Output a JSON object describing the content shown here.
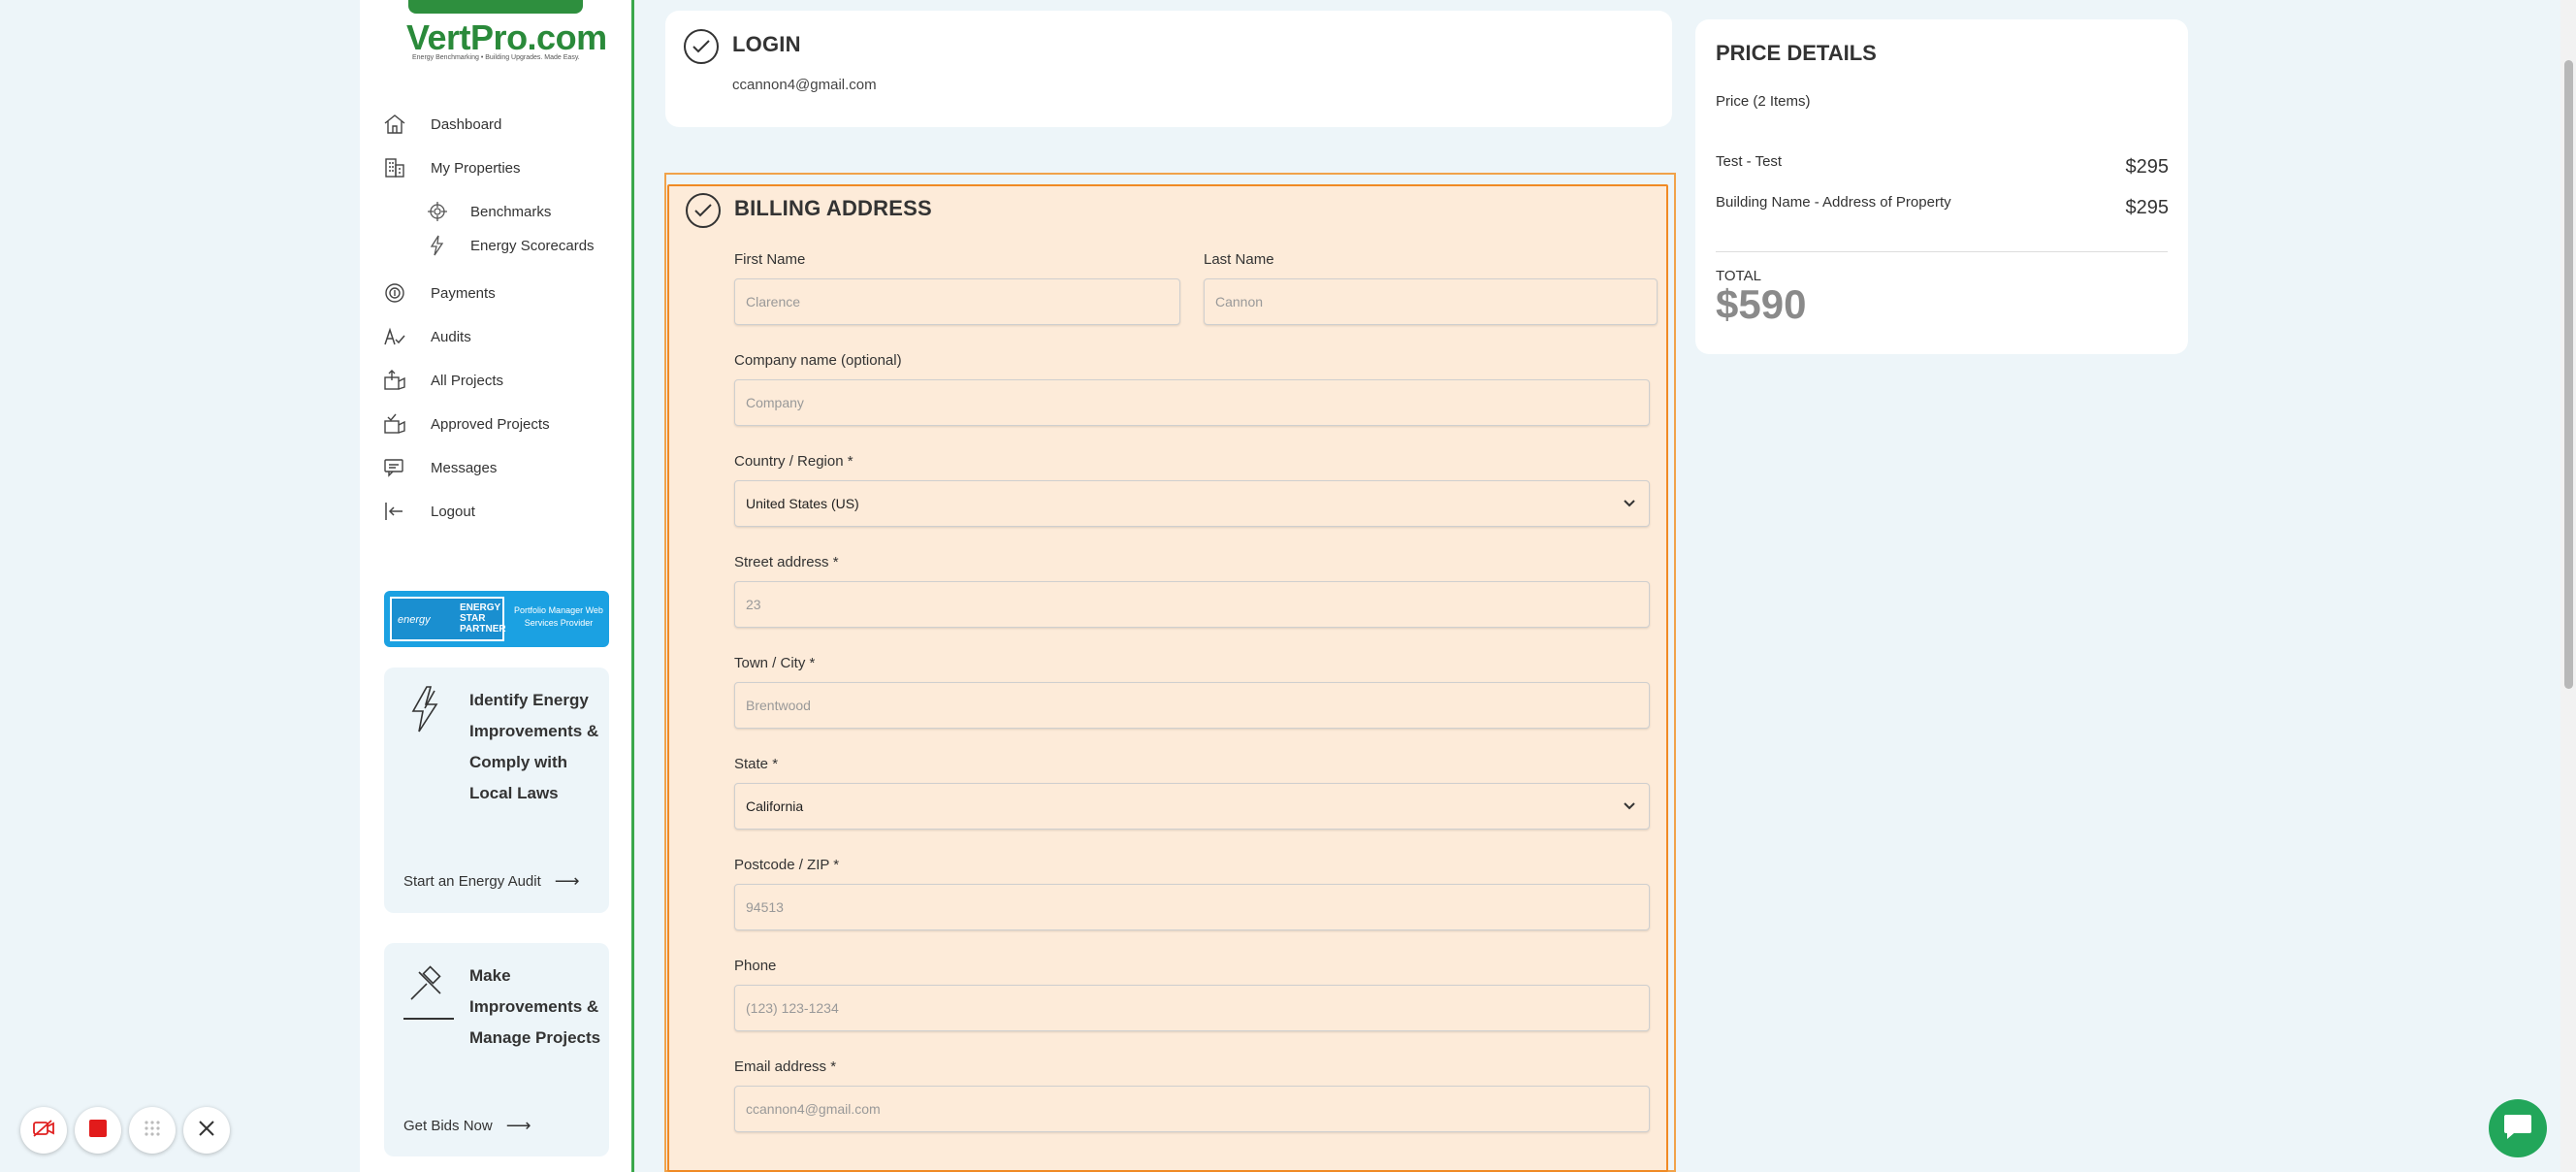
{
  "brand": {
    "logo_text": "VertPro.com",
    "tagline": "Energy Benchmarking • Building Upgrades. Made Easy."
  },
  "sidebar": {
    "items": [
      {
        "label": "Dashboard",
        "icon": "home-icon"
      },
      {
        "label": "My Properties",
        "icon": "building-icon"
      },
      {
        "label": "Benchmarks",
        "icon": "target-icon"
      },
      {
        "label": "Energy Scorecards",
        "icon": "lightning-icon"
      },
      {
        "label": "Payments",
        "icon": "coins-icon"
      },
      {
        "label": "Audits",
        "icon": "audit-check-icon"
      },
      {
        "label": "All Projects",
        "icon": "projects-icon"
      },
      {
        "label": "Approved Projects",
        "icon": "approved-projects-icon"
      },
      {
        "label": "Messages",
        "icon": "messages-icon"
      },
      {
        "label": "Logout",
        "icon": "logout-icon"
      }
    ],
    "energy_star": {
      "box_text": "ENERGY STAR PARTNER",
      "swoosh": "energy",
      "right_text": "Portfolio Manager Web Services Provider"
    },
    "promo1": {
      "title": "Identify Energy Improvements & Comply with Local Laws",
      "link": "Start an Energy Audit"
    },
    "promo2": {
      "title": "Make Improvements & Manage Projects",
      "link": "Get Bids Now"
    }
  },
  "login": {
    "title": "LOGIN",
    "email": "ccannon4@gmail.com"
  },
  "billing": {
    "title": "BILLING ADDRESS",
    "fields": {
      "first_name": {
        "label": "First Name",
        "placeholder": "Clarence"
      },
      "last_name": {
        "label": "Last Name",
        "placeholder": "Cannon"
      },
      "company": {
        "label": "Company name (optional)",
        "placeholder": "Company"
      },
      "country": {
        "label": "Country / Region *",
        "value": "United States (US)"
      },
      "street": {
        "label": "Street address *",
        "placeholder": "23"
      },
      "city": {
        "label": "Town / City *",
        "placeholder": "Brentwood"
      },
      "state": {
        "label": "State *",
        "value": "California"
      },
      "zip": {
        "label": "Postcode / ZIP *",
        "placeholder": "94513"
      },
      "phone": {
        "label": "Phone",
        "placeholder": "(123) 123-1234"
      },
      "email": {
        "label": "Email address *",
        "placeholder": "ccannon4@gmail.com"
      }
    }
  },
  "price": {
    "title": "PRICE DETAILS",
    "subtitle": "Price (2 Items)",
    "items": [
      {
        "label": "Test - Test",
        "value": "$295"
      },
      {
        "label": "Building Name - Address of Property",
        "value": "$295"
      }
    ],
    "total_label": "TOTAL",
    "total_value": "$590"
  },
  "colors": {
    "accent_green": "#3aa84b",
    "highlight_orange": "#f08a24",
    "highlight_fill": "#fdebd9",
    "chat_green": "#22a65a"
  }
}
